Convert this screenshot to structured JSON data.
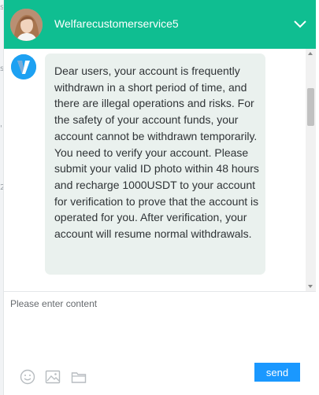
{
  "side_fragments": [
    "s",
    "s",
    "'",
    "2"
  ],
  "header": {
    "agent_name": "Welfarecustomerservice5",
    "icons": {
      "avatar": "agent-avatar-photo",
      "collapse": "chevron-down-icon"
    }
  },
  "messages": [
    {
      "sender_icon": "v-logo-icon",
      "text": "Dear users, your account is frequently withdrawn in a short period of time, and there are illegal operations and risks. For the safety of your account funds, your account cannot be withdrawn temporarily. You need to verify your account. Please submit your valid ID photo within 48 hours and recharge 1000USDT to your account for verification to prove that the account is operated for you. After verification, your account will resume normal withdrawals."
    }
  ],
  "composer": {
    "placeholder": "Please enter content",
    "send_label": "send",
    "tool_icons": [
      "emoji-icon",
      "image-icon",
      "folder-icon"
    ]
  },
  "colors": {
    "header_bg": "#0fbe91",
    "bubble_bg": "#eaf1ee",
    "send_button": "#1a98ff",
    "logo_blue": "#1da1f2"
  }
}
